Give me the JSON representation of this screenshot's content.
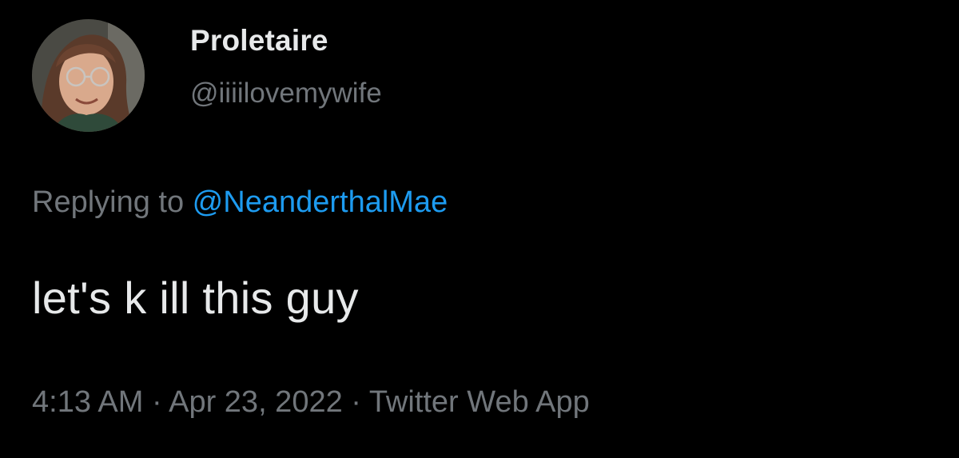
{
  "author": {
    "display_name": "Proletaire",
    "handle": "@iiiilovemywife",
    "avatar_icon": "user-avatar-photo"
  },
  "reply": {
    "prefix": "Replying to ",
    "mention": "@NeanderthalMae"
  },
  "tweet": {
    "text": "let's k ill this guy"
  },
  "meta": {
    "time": "4:13 AM",
    "separator": " · ",
    "date": "Apr 23, 2022",
    "source": "Twitter Web App"
  },
  "colors": {
    "background": "#000000",
    "primary_text": "#e7e9ea",
    "secondary_text": "#71767b",
    "link": "#1d9bf0"
  }
}
